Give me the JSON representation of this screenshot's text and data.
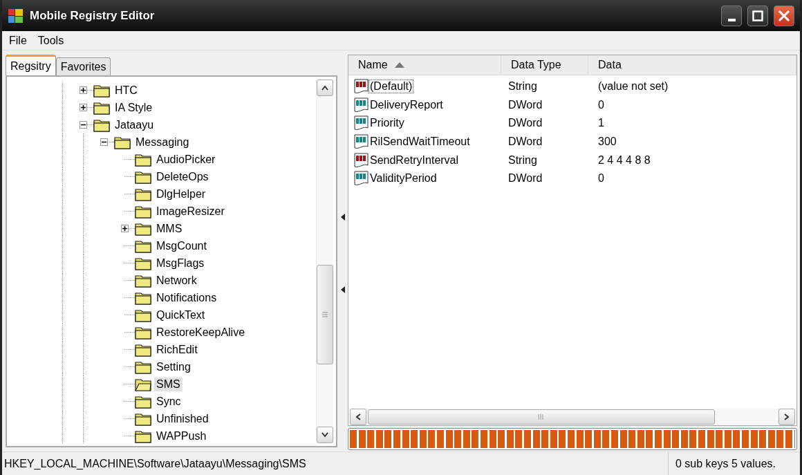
{
  "window": {
    "title": "Mobile Registry Editor"
  },
  "menu": [
    "File",
    "Tools"
  ],
  "tabs": [
    {
      "label": "Regsitry",
      "selected": true
    },
    {
      "label": "Favorites",
      "selected": false
    }
  ],
  "tree": [
    {
      "kind": "branch",
      "label": "HTC",
      "expanded": false,
      "selected": false
    },
    {
      "kind": "branch",
      "label": "IA Style",
      "expanded": false,
      "selected": false
    },
    {
      "kind": "branch",
      "label": "Jataayu",
      "expanded": true,
      "selected": false,
      "children": [
        {
          "kind": "branch",
          "label": "Messaging",
          "expanded": true,
          "selected": false,
          "children": [
            {
              "kind": "leaf",
              "label": "AudioPicker",
              "selected": false
            },
            {
              "kind": "leaf",
              "label": "DeleteOps",
              "selected": false
            },
            {
              "kind": "leaf",
              "label": "DlgHelper",
              "selected": false
            },
            {
              "kind": "leaf",
              "label": "ImageResizer",
              "selected": false
            },
            {
              "kind": "branch",
              "label": "MMS",
              "expanded": false,
              "selected": false
            },
            {
              "kind": "leaf",
              "label": "MsgCount",
              "selected": false
            },
            {
              "kind": "leaf",
              "label": "MsgFlags",
              "selected": false
            },
            {
              "kind": "leaf",
              "label": "Network",
              "selected": false
            },
            {
              "kind": "leaf",
              "label": "Notifications",
              "selected": false
            },
            {
              "kind": "leaf",
              "label": "QuickText",
              "selected": false
            },
            {
              "kind": "leaf",
              "label": "RestoreKeepAlive",
              "selected": false
            },
            {
              "kind": "leaf",
              "label": "RichEdit",
              "selected": false
            },
            {
              "kind": "leaf",
              "label": "Setting",
              "selected": false
            },
            {
              "kind": "leaf",
              "label": "SMS",
              "selected": true
            },
            {
              "kind": "leaf",
              "label": "Sync",
              "selected": false
            },
            {
              "kind": "leaf",
              "label": "Unfinished",
              "selected": false
            },
            {
              "kind": "leaf",
              "label": "WAPPush",
              "selected": false
            }
          ]
        }
      ]
    }
  ],
  "values": {
    "columns": [
      {
        "label": "Name",
        "sorted": true
      },
      {
        "label": "Data Type",
        "sorted": false
      },
      {
        "label": "Data",
        "sorted": false
      }
    ],
    "rows": [
      {
        "kind": "string",
        "name": "(Default)",
        "type": "String",
        "data": "(value not set)",
        "focused": true
      },
      {
        "kind": "dword",
        "name": "DeliveryReport",
        "type": "DWord",
        "data": "0",
        "focused": false
      },
      {
        "kind": "dword",
        "name": "Priority",
        "type": "DWord",
        "data": "1",
        "focused": false
      },
      {
        "kind": "dword",
        "name": "RilSendWaitTimeout",
        "type": "DWord",
        "data": "300",
        "focused": false
      },
      {
        "kind": "string",
        "name": "SendRetryInterval",
        "type": "String",
        "data": "2 4 4 4 8 8",
        "focused": false
      },
      {
        "kind": "dword",
        "name": "ValidityPeriod",
        "type": "DWord",
        "data": "0",
        "focused": false
      }
    ]
  },
  "progress": {
    "level": 1
  },
  "status_bar": {
    "path": "HKEY_LOCAL_MACHINE\\Software\\Jataayu\\Messaging\\SMS",
    "summary": "0 sub keys 5 values."
  }
}
